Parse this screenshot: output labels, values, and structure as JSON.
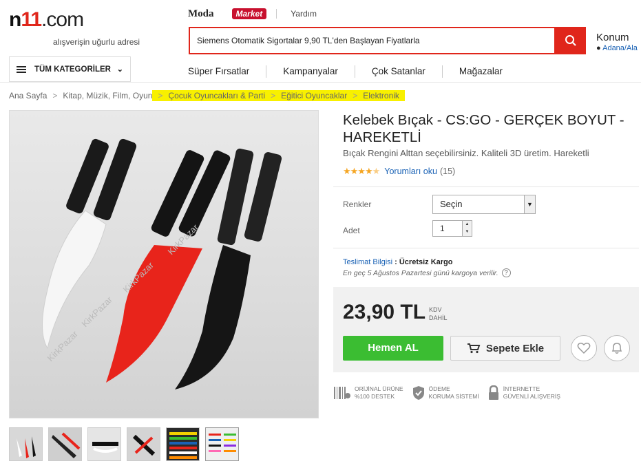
{
  "header": {
    "logo_prefix": "n",
    "logo_one": "11",
    "logo_suffix": ".com",
    "tagline": "alışverişin uğurlu adresi",
    "brand_moda": "Moda",
    "brand_market": "Market",
    "help": "Yardım",
    "search_value": "Siemens Otomatik Sigortalar 9,90 TL'den Başlayan Fiyatlarla",
    "location_title": "Konum",
    "location_value": "Adana/Ala",
    "categories_label": "TÜM KATEGORİLER",
    "nav": [
      "Süper Fırsatlar",
      "Kampanyalar",
      "Çok Satanlar",
      "Mağazalar"
    ]
  },
  "breadcrumb": [
    "Ana Sayfa",
    "Kitap, Müzik, Film, Oyun",
    "Çocuk Oyuncakları & Parti",
    "Eğitici Oyuncaklar",
    "Elektronik"
  ],
  "product": {
    "title": "Kelebek Bıçak - CS:GO - GERÇEK BOYUT - HAREKETLİ",
    "subtitle": "Bıçak Rengini Alttan seçebilirsiniz. Kaliteli 3D üretim. Hareketli",
    "rating": 4.5,
    "reviews_link": "Yorumları oku",
    "reviews_count": "(15)",
    "color_label": "Renkler",
    "color_value": "Seçin",
    "qty_label": "Adet",
    "qty_value": "1",
    "shipping_label": "Teslimat Bilgisi",
    "shipping_value": ": Ücretsiz Kargo",
    "shipping_note": "En geç 5 Ağustos Pazartesi günü kargoya verilir.",
    "price": "23,90 TL",
    "kdv_line1": "KDV",
    "kdv_line2": "DAHİL",
    "buy_label": "Hemen AL",
    "cart_label": "Sepete Ekle",
    "watermark": "KirkPazar"
  },
  "badges": [
    {
      "line1": "ORİJİNAL ÜRÜNE",
      "line2": "%100 DESTEK"
    },
    {
      "line1": "ÖDEME",
      "line2": "KORUMA SİSTEMİ"
    },
    {
      "line1": "İNTERNETTE",
      "line2": "GÜVENLİ ALIŞVERİŞ"
    }
  ],
  "colors": {
    "brand_red": "#e0261b",
    "buy_green": "#3bbd32",
    "link_blue": "#1a62b5",
    "highlight": "#f8f000"
  }
}
